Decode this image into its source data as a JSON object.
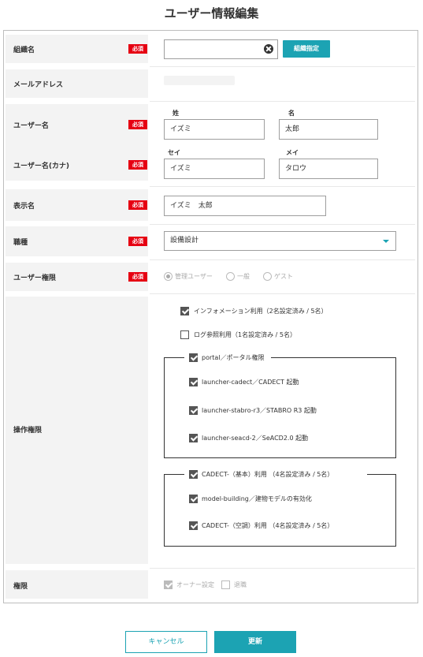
{
  "page_title": "ユーザー情報編集",
  "required_badge": "必須",
  "organization": {
    "label": "組織名",
    "value": "　",
    "assign_button": "組織指定"
  },
  "email": {
    "label": "メールアドレス",
    "value": "　"
  },
  "user_name": {
    "label": "ユーザー名",
    "last_head": "姓",
    "first_head": "名",
    "last_value": "イズミ",
    "first_value": "太郎"
  },
  "user_name_kana": {
    "label": "ユーザー名(カナ)",
    "last_head": "セイ",
    "first_head": "メイ",
    "last_value": "イズミ",
    "first_value": "タロウ"
  },
  "display_name": {
    "label": "表示名",
    "value": "イズミ　太郎"
  },
  "job_type": {
    "label": "職種",
    "selected": "設備設計"
  },
  "user_permission": {
    "label": "ユーザー権限",
    "options": [
      "管理ユーザー",
      "一般",
      "ゲスト"
    ],
    "selected": "管理ユーザー"
  },
  "operation_permission": {
    "label": "操作権限",
    "info_usage": "インフォメーション利用（2名設定済み / 5名）",
    "log_usage": "ログ参照利用（1名設定済み / 5名）",
    "group1": {
      "title": "portal／ポータル権限",
      "items": [
        "launcher-cadect／CADECT 起動",
        "launcher-stabro-r3／STABRO R3 起動",
        "launcher-seacd-2／SeACD2.0 起動"
      ]
    },
    "group2": {
      "title": "CADECT-（基本）利用 （4名設定済み / 5名）",
      "items": [
        "model-building／建物モデルの有効化",
        "CADECT-（空調）利用 （4名設定済み / 5名）"
      ]
    }
  },
  "authority": {
    "label": "権限",
    "owner_setting": "オーナー設定",
    "retired": "退職"
  },
  "footer": {
    "cancel": "キャンセル",
    "update": "更新"
  }
}
